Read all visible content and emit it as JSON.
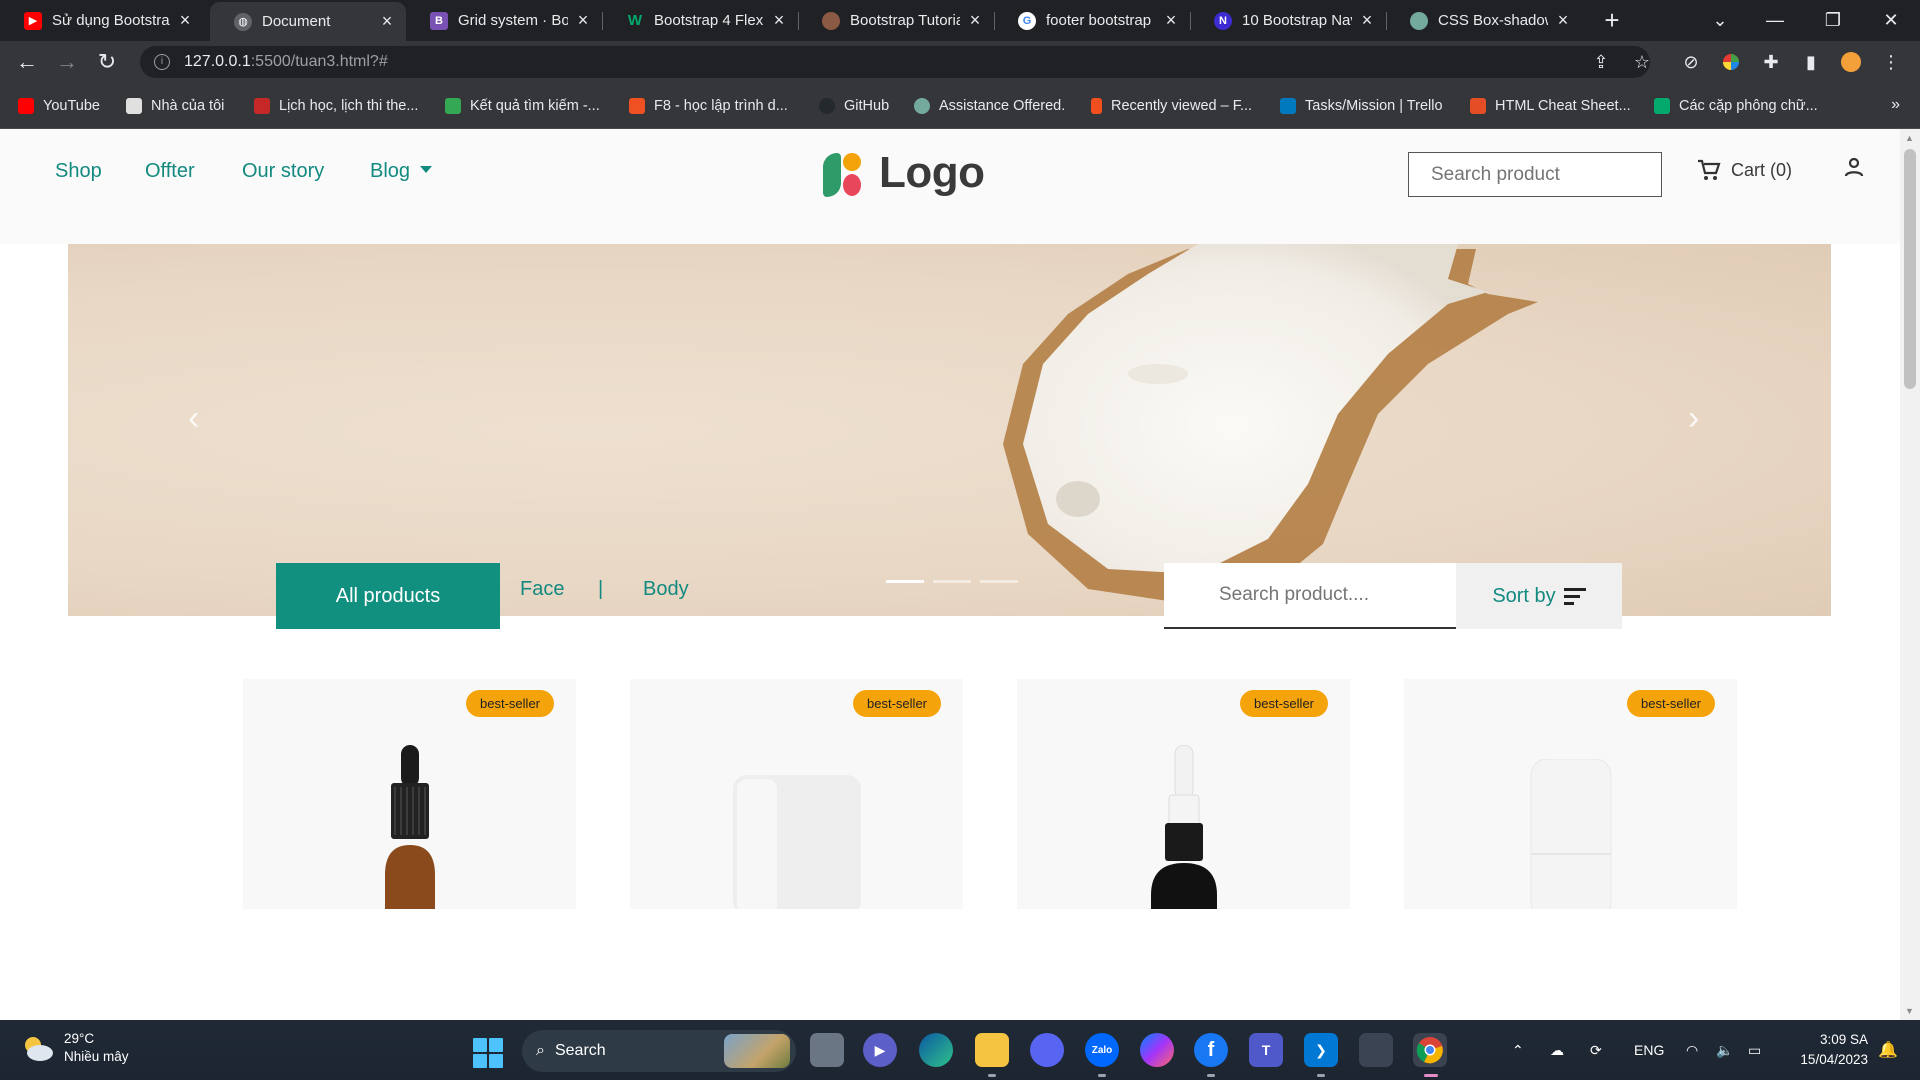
{
  "browser": {
    "tabs": [
      {
        "title": "Sử dụng Bootstra",
        "favicon": "youtube-icon",
        "color": "#ff0000"
      },
      {
        "title": "Document",
        "favicon": "globe-icon",
        "color": "#5f6368",
        "active": true
      },
      {
        "title": "Grid system · Boo",
        "favicon": "bootstrap-icon",
        "color": "#7952b3"
      },
      {
        "title": "Bootstrap 4 Flex",
        "favicon": "w3schools-icon",
        "color": "#04aa6d"
      },
      {
        "title": "Bootstrap Tutoria",
        "favicon": "tutorial-icon",
        "color": "#8a5a44"
      },
      {
        "title": "footer bootstrap",
        "favicon": "google-icon",
        "color": "#4285f4"
      },
      {
        "title": "10 Bootstrap Nav",
        "favicon": "n-icon",
        "color": "#3b2bd1"
      },
      {
        "title": "CSS Box-shadow.",
        "favicon": "chatgpt-icon",
        "color": "#74aa9c"
      }
    ],
    "url_host": "127.0.0.1",
    "url_path": ":5500/tuan3.html?#",
    "bookmarks": [
      {
        "label": "YouTube",
        "color": "#ff0000"
      },
      {
        "label": "Nhà của tôi",
        "color": "#e0e0e0"
      },
      {
        "label": "Lịch học, lịch thi the...",
        "color": "#c62828"
      },
      {
        "label": "Kết quả tìm kiếm -...",
        "color": "#34a853"
      },
      {
        "label": "F8 - học lập trình d...",
        "color": "#f05123"
      },
      {
        "label": "GitHub",
        "color": "#24292e"
      },
      {
        "label": "Assistance Offered.",
        "color": "#74aa9c"
      },
      {
        "label": "Recently viewed – F...",
        "color": "#f24e1e"
      },
      {
        "label": "Tasks/Mission | Trello",
        "color": "#0079bf"
      },
      {
        "label": "HTML Cheat Sheet...",
        "color": "#e44d26"
      },
      {
        "label": "Các cặp phông chữ...",
        "color": "#04aa6d"
      }
    ]
  },
  "site": {
    "nav": [
      "Shop",
      "Offter",
      "Our story",
      "Blog"
    ],
    "logo_text": "Logo",
    "search_placeholder": "Search product",
    "cart_label": "Cart (0)",
    "filters": {
      "all": "All products",
      "face": "Face",
      "separator": "|",
      "body": "Body"
    },
    "product_search_placeholder": "Search product....",
    "sort_label": "Sort by",
    "badge": "best-seller",
    "products": [
      {
        "badge": "best-seller",
        "kind": "amber-dropper-bottle"
      },
      {
        "badge": "best-seller",
        "kind": "white-jar"
      },
      {
        "badge": "best-seller",
        "kind": "black-dropper-bottle"
      },
      {
        "badge": "best-seller",
        "kind": "white-tube"
      }
    ],
    "colors": {
      "accent": "#12907f",
      "badge": "#f4a30a"
    }
  },
  "taskbar": {
    "temperature": "29°C",
    "weather": "Nhiều mây",
    "search_label": "Search",
    "language": "ENG",
    "time": "3:09 SA",
    "date": "15/04/2023"
  }
}
